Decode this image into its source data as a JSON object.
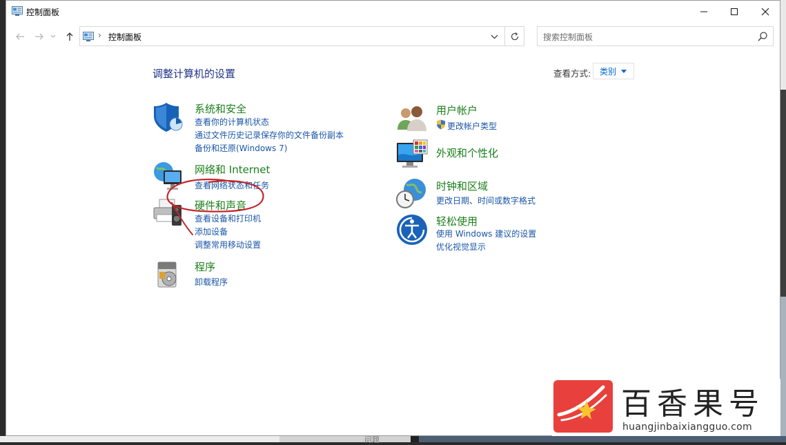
{
  "window": {
    "title": "控制面板"
  },
  "address": {
    "breadcrumb": "控制面板"
  },
  "search": {
    "placeholder": "搜索控制面板"
  },
  "content": {
    "heading": "调整计算机的设置",
    "viewby_label": "查看方式:",
    "viewby_value": "类别"
  },
  "categories": {
    "system": {
      "title": "系统和安全",
      "links": [
        "查看你的计算机状态",
        "通过文件历史记录保存你的文件备份副本",
        "备份和还原(Windows 7)"
      ]
    },
    "network": {
      "title": "网络和 Internet",
      "links": [
        "查看网络状态和任务"
      ]
    },
    "hardware": {
      "title": "硬件和声音",
      "links": [
        "查看设备和打印机",
        "添加设备",
        "调整常用移动设置"
      ]
    },
    "programs": {
      "title": "程序",
      "links": [
        "卸载程序"
      ]
    },
    "users": {
      "title": "用户帐户",
      "links": [
        "更改帐户类型"
      ]
    },
    "appearance": {
      "title": "外观和个性化",
      "links": []
    },
    "clock": {
      "title": "时钟和区域",
      "links": [
        "更改日期、时间或数字格式"
      ]
    },
    "ease": {
      "title": "轻松使用",
      "links": [
        "使用 Windows 建议的设置",
        "优化视觉显示"
      ]
    }
  },
  "taskbar_hint": "问题",
  "watermark": {
    "brand": "百香果号",
    "url": "huangjinbaixiangguo.com"
  },
  "colors": {
    "category_title": "#1a7f1a",
    "link": "#1a56a8",
    "heading": "#1e3287",
    "annotation": "#c0282d",
    "watermark_red": "#e8403c"
  }
}
